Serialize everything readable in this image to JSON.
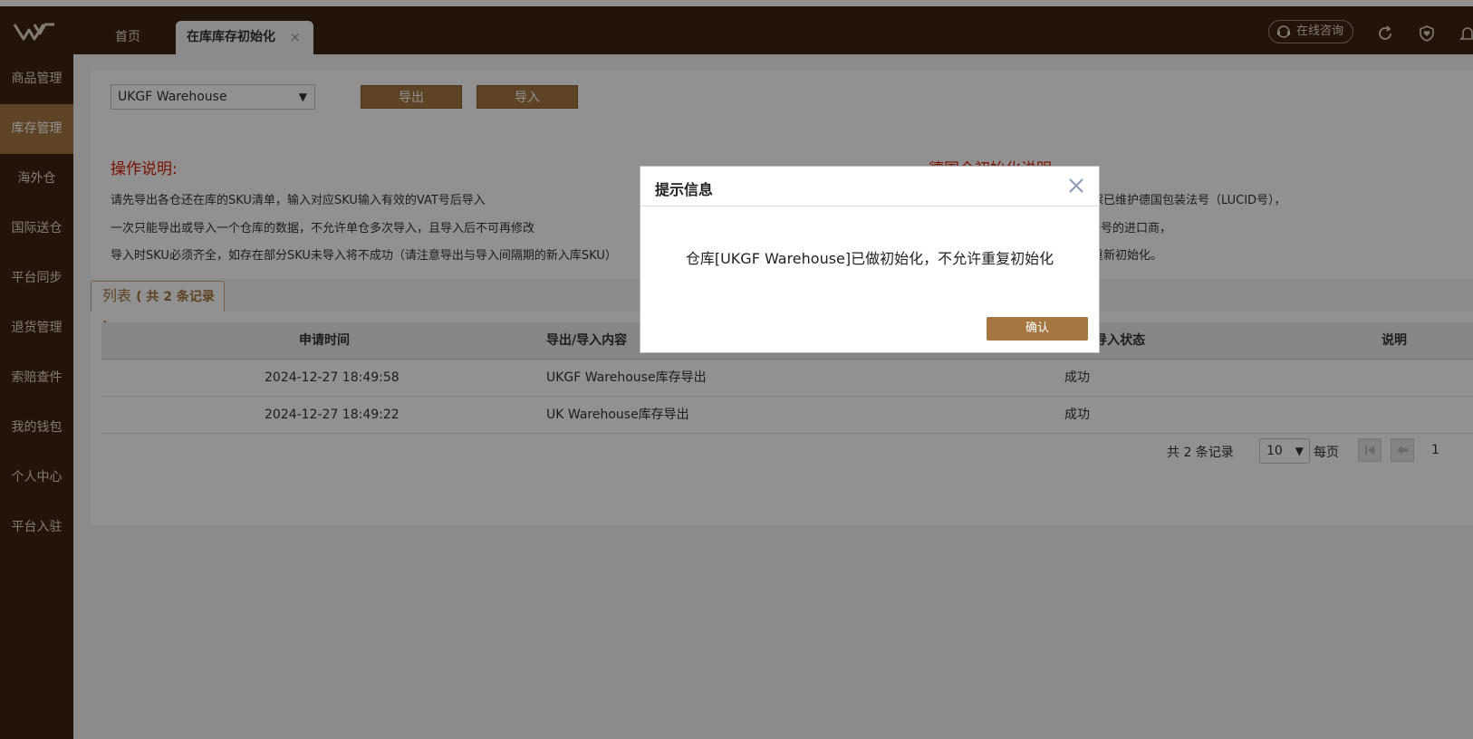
{
  "header": {
    "tabs": [
      {
        "label": "首页"
      },
      {
        "label": "在库库存初始化"
      }
    ],
    "tab_close_glyph": "×",
    "consult_label": "在线咨询",
    "icons": [
      "headset-icon",
      "refresh-icon",
      "heart-shield-icon",
      "bell-icon"
    ]
  },
  "sidebar": {
    "items": [
      {
        "label": "商品管理"
      },
      {
        "label": "库存管理"
      },
      {
        "label": "海外仓"
      },
      {
        "label": "国际送仓"
      },
      {
        "label": "平台同步"
      },
      {
        "label": "退货管理"
      },
      {
        "label": "索赔查件"
      },
      {
        "label": "我的钱包"
      },
      {
        "label": "个人中心"
      },
      {
        "label": "平台入驻"
      }
    ],
    "active_index": 1
  },
  "toolbar": {
    "warehouse_selected": "UKGF Warehouse",
    "export_label": "导出",
    "import_label": "导入"
  },
  "instructions": {
    "title": "操作说明:",
    "lines": [
      "请先导出各仓还在库的SKU清单，输入对应SKU输入有效的VAT号后导入",
      "一次只能导出或导入一个仓库的数据，不允许单仓多次导入，且导入后不可再修改",
      "导入时SKU必须齐全，如存在部分SKU未导入将不成功（请注意导出与导入间隔期的新入库SKU）"
    ]
  },
  "germany_notes": {
    "title": "德国仓初始化说明:",
    "lines": [
      "保已维护德国包装法号（LUCID号），",
      "D号的进口商，",
      "重新初始化。"
    ]
  },
  "list": {
    "tab_label": "列表",
    "count_text": "( 共 2 条记录 )",
    "columns": [
      "申请时间",
      "导出/导入内容",
      "导出/导入状态",
      "说明"
    ],
    "rows": [
      {
        "time": "2024-12-27 18:49:58",
        "content": "UKGF Warehouse库存导出",
        "status": "成功",
        "note": ""
      },
      {
        "time": "2024-12-27 18:49:22",
        "content": "UK Warehouse库存导出",
        "status": "成功",
        "note": ""
      }
    ]
  },
  "pager": {
    "total_text": "共 2 条记录",
    "page_size": "10",
    "per_page_label": "每页",
    "page_number_partial": "1"
  },
  "dialog": {
    "title": "提示信息",
    "message": "仓库[UKGF Warehouse]已做初始化，不允许重复初始化",
    "ok_label": "确认"
  },
  "colors": {
    "brand_dark": "#3f2410",
    "accent": "#a57640",
    "warning_red": "#d81e06"
  }
}
